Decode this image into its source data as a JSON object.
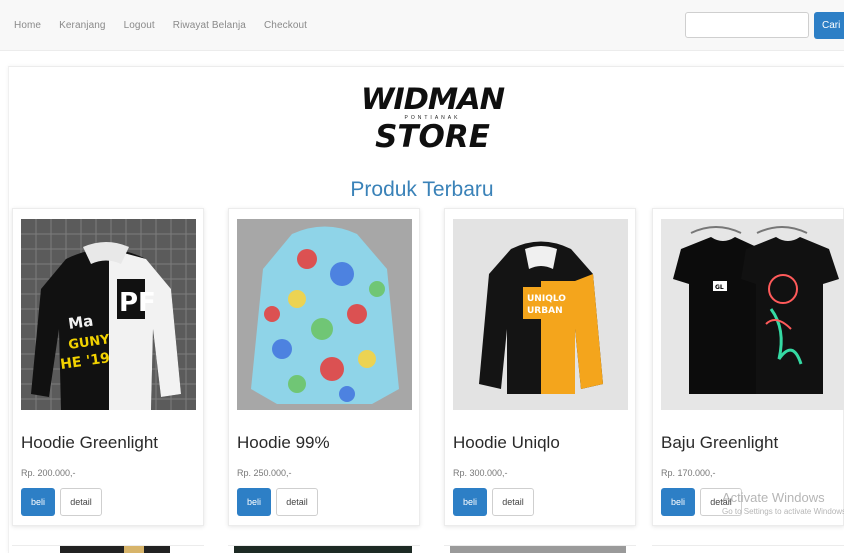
{
  "nav": {
    "links": [
      "Home",
      "Keranjang",
      "Logout",
      "Riwayat Belanja",
      "Checkout"
    ],
    "search_placeholder": "",
    "search_button": "Cari"
  },
  "logo": {
    "line1": "WIDMAN",
    "tagline": "PONTIANAK",
    "line2": "STORE"
  },
  "section_title": "Produk Terbaru",
  "products": [
    {
      "name": "Hoodie Greenlight",
      "price": "Rp. 200.000,-",
      "buy_label": "beli",
      "detail_label": "detail"
    },
    {
      "name": "Hoodie 99%",
      "price": "Rp. 250.000,-",
      "buy_label": "beli",
      "detail_label": "detail"
    },
    {
      "name": "Hoodie Uniqlo",
      "price": "Rp. 300.000,-",
      "buy_label": "beli",
      "detail_label": "detail"
    },
    {
      "name": "Baju Greenlight",
      "price": "Rp. 170.000,-",
      "buy_label": "beli",
      "detail_label": "detail"
    }
  ],
  "watermark": {
    "title": "Activate Windows",
    "subtitle": "Go to Settings to activate Windows."
  },
  "colors": {
    "accent": "#2d7fc6",
    "title": "#3a82b8"
  }
}
